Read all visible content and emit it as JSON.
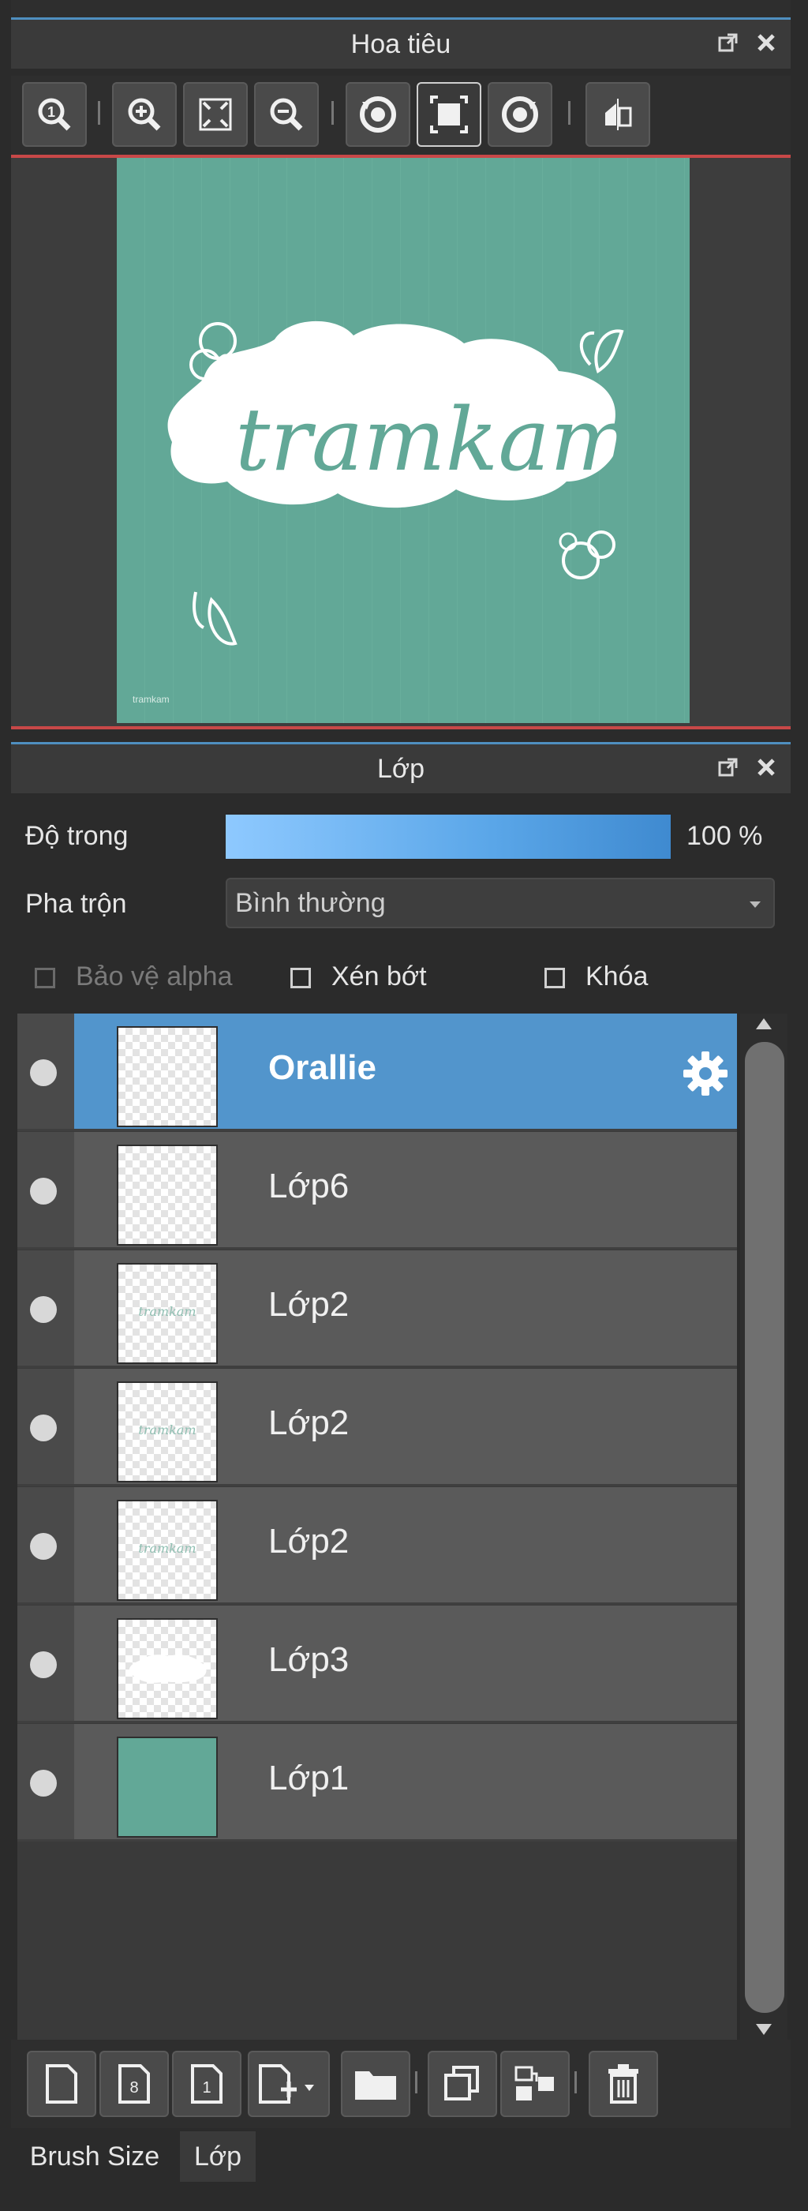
{
  "navigator": {
    "title": "Hoa tiêu",
    "toolbar": [
      "zoom-actual-icon",
      "zoom-in-icon",
      "fit-screen-icon",
      "zoom-out-icon",
      "rotate-left-icon",
      "fit-window-icon",
      "rotate-right-icon",
      "flip-icon"
    ],
    "canvas_text": "tramkam",
    "canvas_small": "tramkam"
  },
  "layer_panel": {
    "title": "Lớp",
    "opacity_label": "Độ trong",
    "opacity_value": "100 %",
    "opacity_fraction": 1.0,
    "blend_label": "Pha trộn",
    "blend_value": "Bình thường",
    "protect_alpha": "Bảo vệ alpha",
    "clipping": "Xén bớt",
    "lock": "Khóa",
    "layers": [
      {
        "name": "Orallie",
        "selected": true,
        "thumb": "empty"
      },
      {
        "name": "Lớp6",
        "selected": false,
        "thumb": "empty"
      },
      {
        "name": "Lớp2",
        "selected": false,
        "thumb": "text"
      },
      {
        "name": "Lớp2",
        "selected": false,
        "thumb": "text"
      },
      {
        "name": "Lớp2",
        "selected": false,
        "thumb": "text"
      },
      {
        "name": "Lớp3",
        "selected": false,
        "thumb": "cloud"
      },
      {
        "name": "Lớp1",
        "selected": false,
        "thumb": "solid"
      }
    ],
    "thumb_text": "tramkam"
  },
  "bottom_tabs": {
    "brush_size": "Brush Size",
    "layer": "Lớp"
  },
  "colors": {
    "accent": "#5295cc",
    "canvas": "#62a897",
    "panel": "#2b2b2b"
  }
}
